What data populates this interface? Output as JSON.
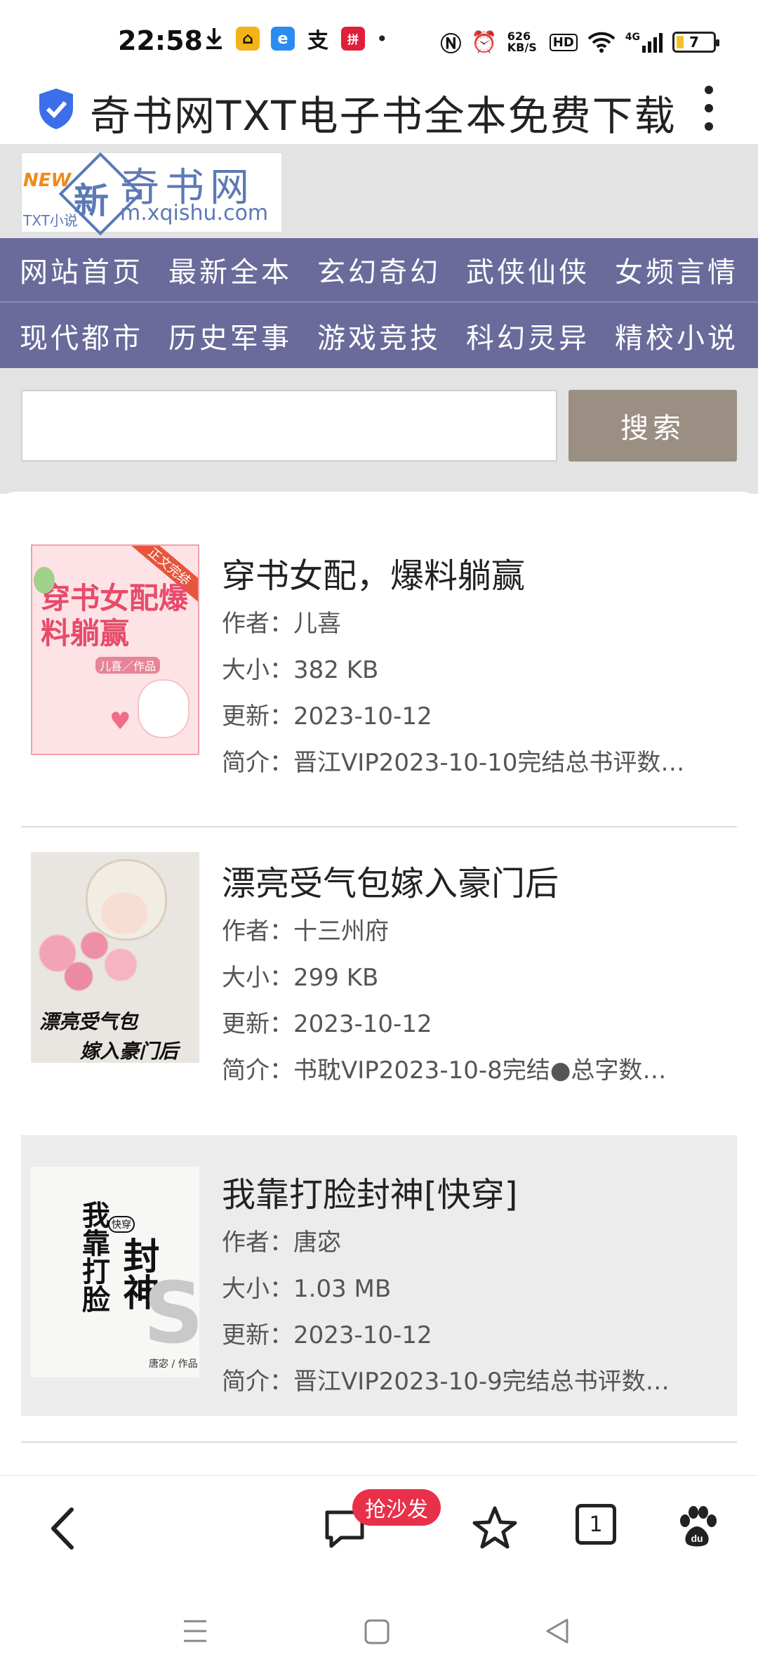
{
  "status": {
    "time": "22:58",
    "net_speed": "626 KB/S",
    "hd": "HD",
    "signal": "4G",
    "battery": "7"
  },
  "browser": {
    "title": "奇书网TXT电子书全本免费下载"
  },
  "site": {
    "logo": {
      "new": "NEW",
      "xin": "新",
      "name": "奇书网",
      "url": "m.xqishu.com",
      "tag": "TXT小说"
    },
    "nav_row1": [
      "网站首页",
      "最新全本",
      "玄幻奇幻",
      "武侠仙侠",
      "女频言情"
    ],
    "nav_row2": [
      "现代都市",
      "历史军事",
      "游戏竞技",
      "科幻灵异",
      "精校小说"
    ],
    "search": {
      "placeholder": "",
      "button": "搜索"
    }
  },
  "books": [
    {
      "title": "穿书女配，爆料躺赢",
      "author": "作者：儿喜",
      "size": "大小：382 KB",
      "updated": "更新：2023-10-12",
      "desc": "简介：晋江VIP2023-10-10完结总书评数…",
      "cover_text": "穿书女配爆料躺赢",
      "cover_sub": "儿喜／作品",
      "cover_tag": "正文完结"
    },
    {
      "title": "漂亮受气包嫁入豪门后",
      "author": "作者：十三州府",
      "size": "大小：299 KB",
      "updated": "更新：2023-10-12",
      "desc": "简介：书耽VIP2023-10-8完结●总字数…",
      "cover_text1": "漂亮受气包",
      "cover_text2": "嫁入豪门后"
    },
    {
      "title": "我靠打脸封神[快穿]",
      "author": "作者：唐宓",
      "size": "大小：1.03 MB",
      "updated": "更新：2023-10-12",
      "desc": "简介：晋江VIP2023-10-9完结总书评数…",
      "cover_text1": "我靠打脸",
      "cover_text2": "封神",
      "cover_tag": "快穿",
      "cover_author": "唐宓 / 作品"
    }
  ],
  "toolbar": {
    "badge": "抢沙发",
    "tabs": "1"
  },
  "colors": {
    "nav": "#6a6a9b",
    "search_button": "#9b8e82",
    "badge": "#e8304a",
    "shield": "#3b6ee8"
  }
}
